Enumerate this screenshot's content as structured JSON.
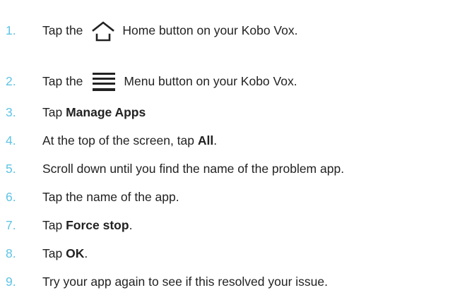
{
  "steps": [
    {
      "number": "1.",
      "pre": "Tap the",
      "icon": "home-icon",
      "post": "Home button on your Kobo Vox."
    },
    {
      "number": "2.",
      "pre": "Tap the",
      "icon": "menu-icon",
      "post": "Menu button on your Kobo Vox."
    },
    {
      "number": "3.",
      "pre": "Tap",
      "bold": "Manage Apps",
      "post": ""
    },
    {
      "number": "4.",
      "pre": "At the top of the screen, tap",
      "bold": "All",
      "post": "."
    },
    {
      "number": "5.",
      "pre": "Scroll down until you find the name of the problem app.",
      "bold": "",
      "post": ""
    },
    {
      "number": "6.",
      "pre": "Tap the name of the app.",
      "bold": "",
      "post": ""
    },
    {
      "number": "7.",
      "pre": "Tap",
      "bold": "Force stop",
      "post": "."
    },
    {
      "number": "8.",
      "pre": "Tap",
      "bold": "OK",
      "post": "."
    },
    {
      "number": "9.",
      "pre": "Try your app again to see if this resolved your issue.",
      "bold": "",
      "post": ""
    }
  ],
  "colors": {
    "number": "#5ec4e4",
    "text": "#222222",
    "icon": "#222222"
  }
}
